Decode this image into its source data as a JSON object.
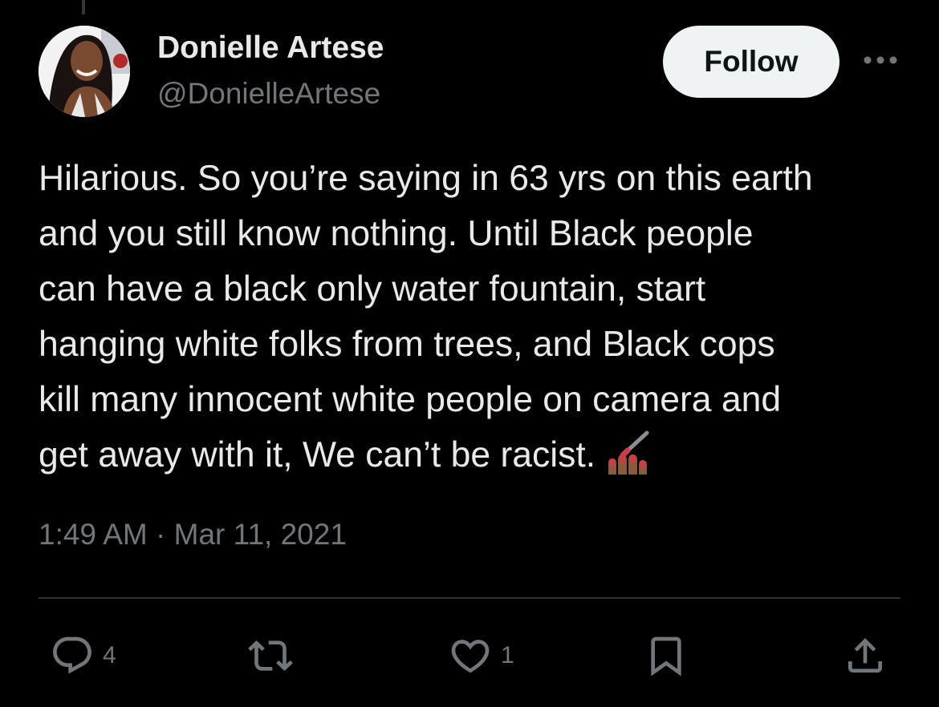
{
  "tweet": {
    "author": {
      "display_name": "Donielle Artese",
      "handle": "@DonielleArtese"
    },
    "follow_label": "Follow",
    "text_lines": [
      "Hilarious. So you’re saying in 63 yrs on this earth",
      "and you still know nothing. Until Black people",
      "can have a black only water fountain, start",
      "hanging white folks from trees, and Black cops",
      "kill many innocent white people on camera and",
      "get away with it, We can’t be racist."
    ],
    "emoji": "nail-polish-emoji",
    "timestamp": "1:49 AM · Mar 11, 2021",
    "actions": {
      "reply_count": "4",
      "like_count": "1"
    }
  },
  "icons": {
    "more": "more-dots-icon",
    "reply": "reply-bubble-icon",
    "retweet": "retweet-icon",
    "like": "heart-icon",
    "bookmark": "bookmark-icon",
    "share": "share-icon"
  },
  "colors": {
    "background": "#000000",
    "primary_text": "#e7e9ea",
    "secondary_text": "#71767b",
    "follow_button_bg": "#eff3f4",
    "divider": "#2f3336"
  }
}
